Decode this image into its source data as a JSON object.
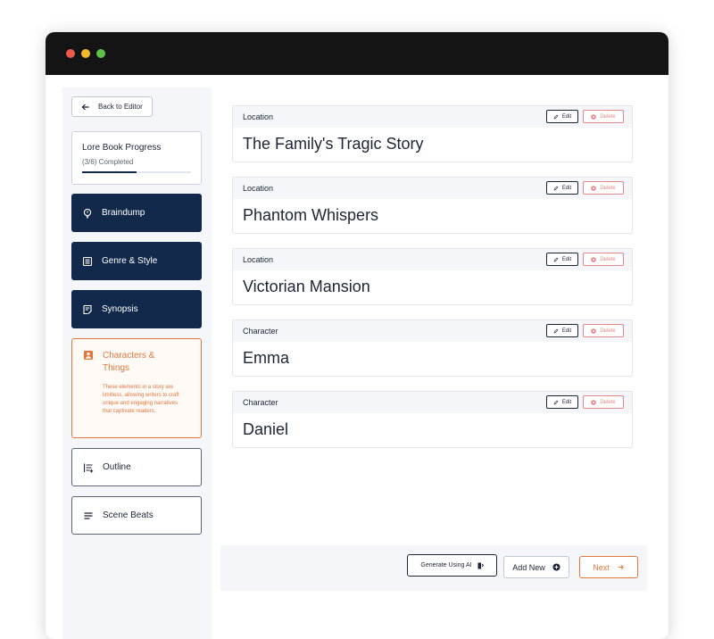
{
  "sidebar": {
    "back_label": "Back to Editor",
    "progress": {
      "title": "Lore Book Progress",
      "status": "(3/6) Completed",
      "fraction": 0.5
    },
    "items": [
      {
        "label": "Braindump",
        "icon": "lightbulb-icon",
        "state": "completed"
      },
      {
        "label": "Genre & Style",
        "icon": "list-icon",
        "state": "completed"
      },
      {
        "label": "Synopsis",
        "icon": "document-edit-icon",
        "state": "completed"
      },
      {
        "label": "Characters & Things",
        "icon": "person-badge-icon",
        "state": "active",
        "description": "These elements in a story are limitless, allowing writers to craft unique and engaging narratives that captivate readers."
      },
      {
        "label": "Outline",
        "icon": "outline-list-icon",
        "state": "pending"
      },
      {
        "label": "Scene Beats",
        "icon": "lines-icon",
        "state": "pending"
      }
    ]
  },
  "entries": [
    {
      "type": "Location",
      "name": "The Family's Tragic Story"
    },
    {
      "type": "Location",
      "name": "Phantom Whispers"
    },
    {
      "type": "Location",
      "name": "Victorian Mansion"
    },
    {
      "type": "Character",
      "name": "Emma"
    },
    {
      "type": "Character",
      "name": "Daniel"
    }
  ],
  "entry_actions": {
    "edit_label": "Edit",
    "delete_label": "Delete"
  },
  "footer": {
    "generate_label": "Generate Using AI",
    "add_label": "Add New",
    "next_label": "Next"
  },
  "colors": {
    "navy": "#13294b",
    "accent_orange": "#e2773e",
    "delete_red": "#e5868a"
  }
}
